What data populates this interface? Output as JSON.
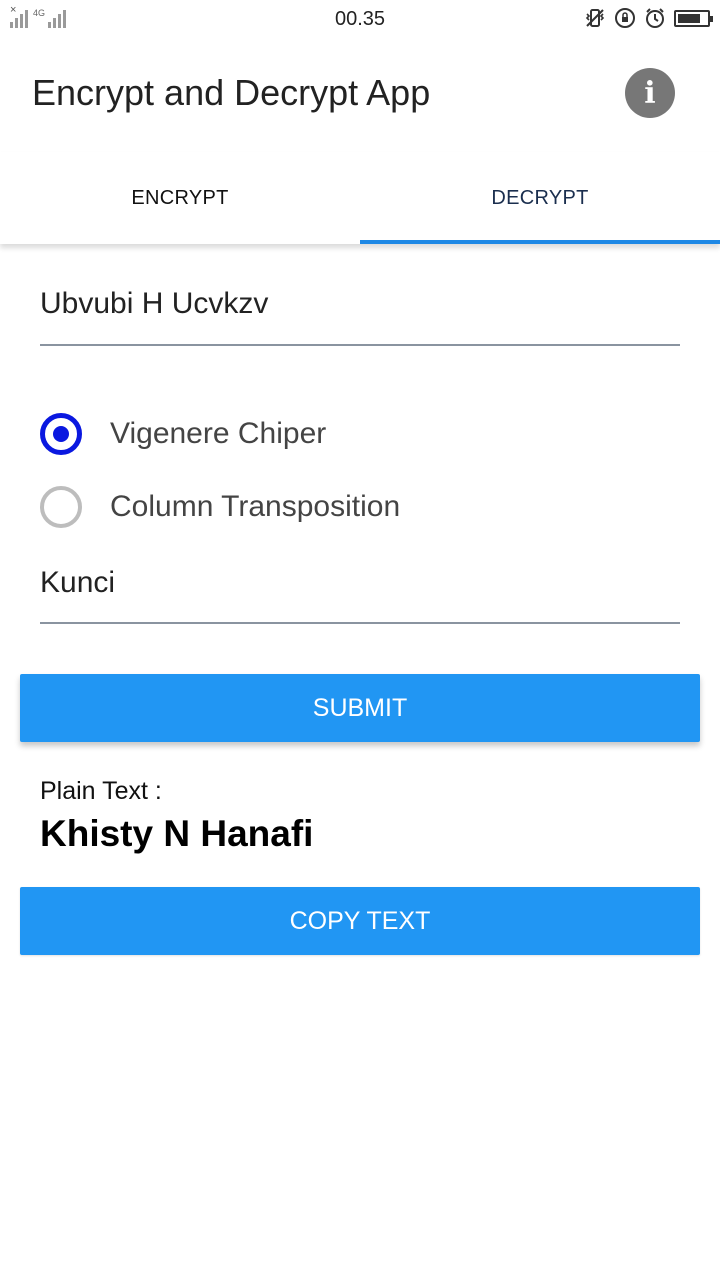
{
  "status_bar": {
    "network": "4G",
    "time": "00.35",
    "icons": [
      "signal-icon",
      "vibrate-icon",
      "rotation-lock-icon",
      "alarm-icon",
      "battery-icon"
    ],
    "battery_level": 0.8
  },
  "app_bar": {
    "title": "Encrypt and Decrypt App",
    "info_icon": "info-icon"
  },
  "tabs": {
    "items": [
      {
        "label": "ENCRYPT",
        "active": false
      },
      {
        "label": "DECRYPT",
        "active": true
      }
    ],
    "indicator_color": "#1e88e5"
  },
  "form": {
    "cipher_text_value": "Ubvubi H Ucvkzv",
    "methods": [
      {
        "label": "Vigenere Chiper",
        "selected": true
      },
      {
        "label": "Column Transposition",
        "selected": false
      }
    ],
    "key_placeholder": "Kunci",
    "submit_label": "SUBMIT"
  },
  "result": {
    "label": "Plain Text :",
    "value": "Khisty N Hanafi",
    "copy_label": "COPY TEXT"
  },
  "colors": {
    "button": "#2196f3",
    "radio_selected": "#0a18e0",
    "radio_unselected": "#bdbdbd"
  }
}
